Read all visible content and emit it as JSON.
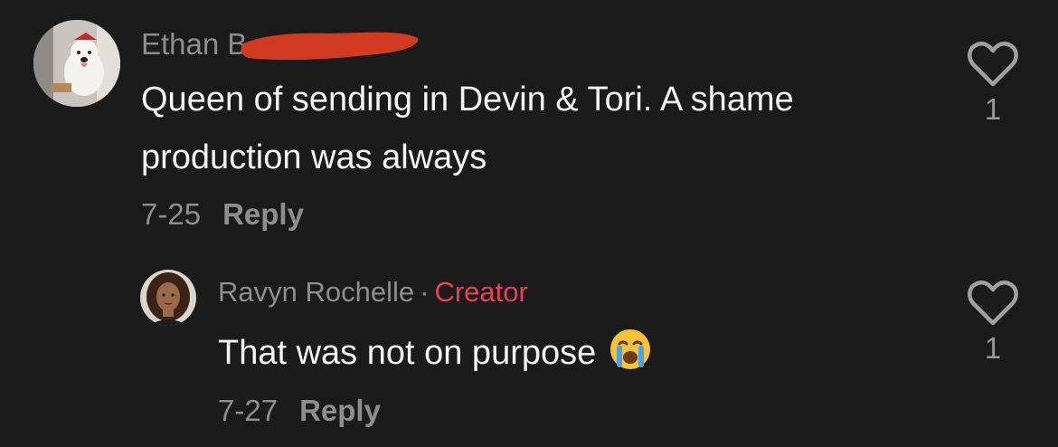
{
  "comments": [
    {
      "author": "Ethan B",
      "text_lines": [
        "Queen of sending in Devin & Tori. A shame",
        "production was always"
      ],
      "date": "7-25",
      "reply_label": "Reply",
      "likes": "1",
      "avatar_icon": "dog-avatar"
    },
    {
      "author": "Ravyn Rochelle",
      "separator": "·",
      "badge": "Creator",
      "text": "That was not on purpose",
      "emoji": "loudly-crying-face-emoji",
      "date": "7-27",
      "reply_label": "Reply",
      "likes": "1",
      "avatar_icon": "woman-avatar"
    }
  ],
  "colors": {
    "background": "#1b1b1b",
    "creator_badge": "#e8405a",
    "redaction": "#d23a22",
    "muted_text": "#8e8e8e"
  }
}
